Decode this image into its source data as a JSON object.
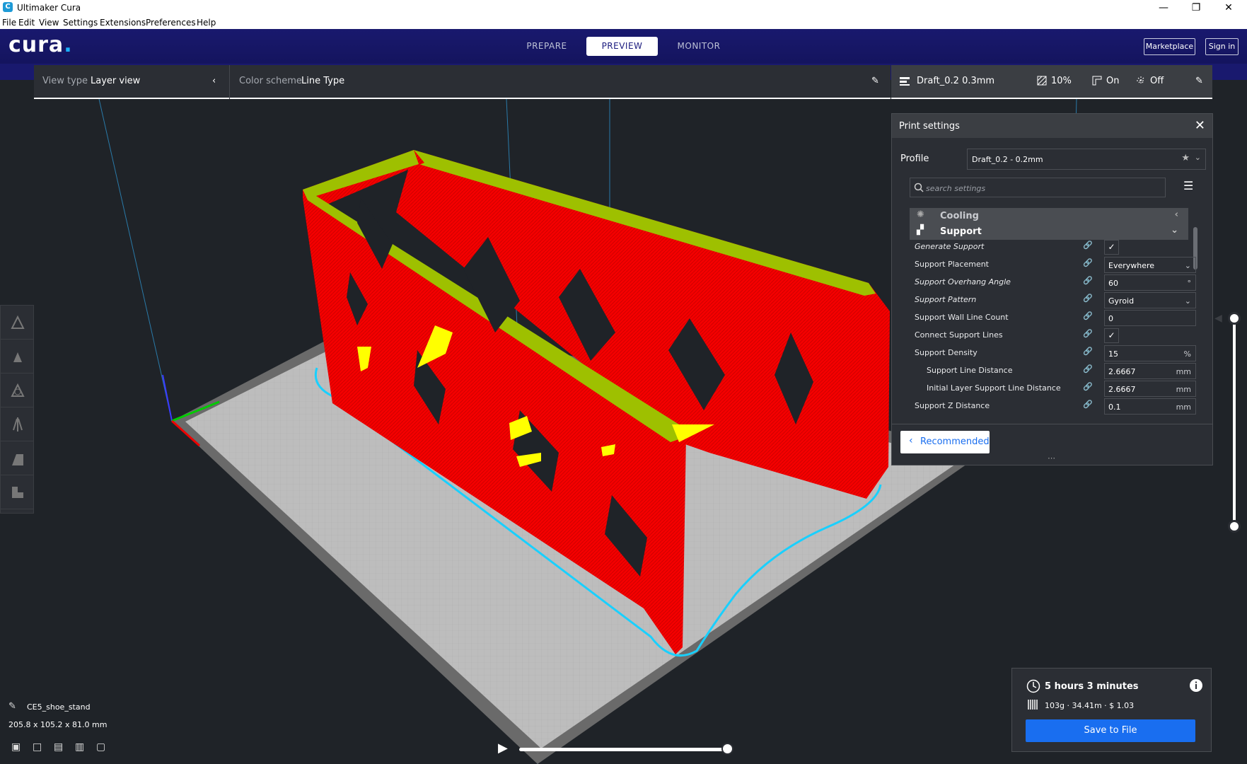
{
  "window": {
    "title": "Ultimaker Cura",
    "menu": [
      "File",
      "Edit",
      "View",
      "Settings",
      "Extensions",
      "Preferences",
      "Help"
    ]
  },
  "header": {
    "logo": "cura",
    "stages": [
      "PREPARE",
      "PREVIEW",
      "MONITOR"
    ],
    "active_stage": "PREVIEW",
    "marketplace": "Marketplace",
    "signin": "Sign in"
  },
  "viewbar": {
    "view_type_label": "View type",
    "view_type_value": "Layer view",
    "color_scheme_label": "Color scheme",
    "color_scheme_value": "Line Type"
  },
  "printbar": {
    "profile": "Draft_0.2 0.3mm",
    "infill": "10%",
    "support": "On",
    "adhesion": "Off"
  },
  "print_settings": {
    "title": "Print settings",
    "profile_label": "Profile",
    "profile_value": "Draft_0.2 - 0.2mm",
    "search_placeholder": "search settings",
    "categories": [
      "Cooling",
      "Support"
    ],
    "settings": [
      {
        "name": "Generate Support",
        "type": "check",
        "value": "✓",
        "unit": ""
      },
      {
        "name": "Support Placement",
        "type": "select",
        "value": "Everywhere",
        "unit": ""
      },
      {
        "name": "Support Overhang Angle",
        "type": "text",
        "value": "60",
        "unit": "°"
      },
      {
        "name": "Support Pattern",
        "type": "select",
        "value": "Gyroid",
        "unit": ""
      },
      {
        "name": "Support Wall Line Count",
        "type": "text",
        "value": "0",
        "unit": ""
      },
      {
        "name": "Connect Support Lines",
        "type": "check",
        "value": "✓",
        "unit": ""
      },
      {
        "name": "Support Density",
        "type": "text",
        "value": "15",
        "unit": "%"
      },
      {
        "name": "Support Line Distance",
        "type": "text",
        "value": "2.6667",
        "unit": "mm"
      },
      {
        "name": "Initial Layer Support Line Distance",
        "type": "text",
        "value": "2.6667",
        "unit": "mm"
      },
      {
        "name": "Support Z Distance",
        "type": "text",
        "value": "0.1",
        "unit": "mm"
      }
    ],
    "recommended": "Recommended"
  },
  "object": {
    "name": "CE5_shoe_stand",
    "dimensions": "205.8 x 105.2 x 81.0 mm"
  },
  "output": {
    "time": "5 hours 3 minutes",
    "material": "103g · 34.41m · $ 1.03",
    "save": "Save to File"
  },
  "colors": {
    "header": "#19196e",
    "accent": "#196ef0",
    "model_wall": "#ff0000",
    "model_skin": "#ffff00",
    "skirt": "#00d8ff"
  }
}
